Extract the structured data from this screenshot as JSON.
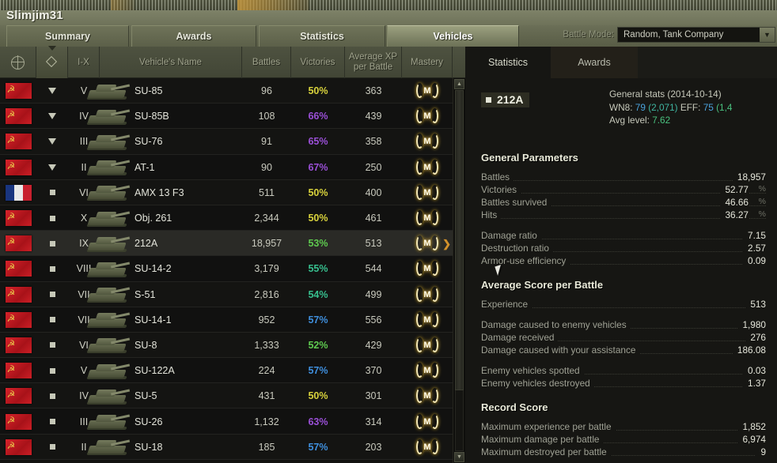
{
  "account": {
    "nickname": "Slimjim31"
  },
  "main_tabs": [
    {
      "label": "Summary",
      "active": false
    },
    {
      "label": "Awards",
      "active": false
    },
    {
      "label": "Statistics",
      "active": false
    },
    {
      "label": "Vehicles",
      "active": true
    }
  ],
  "battle_mode": {
    "label": "Battle Mode:",
    "value": "Random, Tank Company",
    "arrow_icon": "chevron-down-icon"
  },
  "table": {
    "columns": [
      {
        "key": "nation",
        "label": "",
        "icon": "globe-icon"
      },
      {
        "key": "class",
        "label": "",
        "icon": "vehicle-class-icon",
        "sorted": true
      },
      {
        "key": "tier",
        "label": "I-X"
      },
      {
        "key": "name",
        "label": "Vehicle's Name"
      },
      {
        "key": "battles",
        "label": "Battles"
      },
      {
        "key": "victories",
        "label": "Victories"
      },
      {
        "key": "avg_xp",
        "label": "Average XP\nper Battle",
        "line1": "Average XP",
        "line2": "per Battle"
      },
      {
        "key": "mastery",
        "label": "Mastery"
      }
    ],
    "rows": [
      {
        "nation": "ussr",
        "class": "td",
        "tier": "V",
        "name": "SU-85",
        "battles": "96",
        "victories": "50%",
        "pct_color": "#d8d23c",
        "avg_xp": "363",
        "mastery": "M",
        "selected": false
      },
      {
        "nation": "ussr",
        "class": "td",
        "tier": "IV",
        "name": "SU-85B",
        "battles": "108",
        "victories": "66%",
        "pct_color": "#9a4fd6",
        "avg_xp": "439",
        "mastery": "M",
        "selected": false
      },
      {
        "nation": "ussr",
        "class": "td",
        "tier": "III",
        "name": "SU-76",
        "battles": "91",
        "victories": "65%",
        "pct_color": "#9a4fd6",
        "avg_xp": "358",
        "mastery": "M",
        "selected": false
      },
      {
        "nation": "ussr",
        "class": "td",
        "tier": "II",
        "name": "AT-1",
        "battles": "90",
        "victories": "67%",
        "pct_color": "#9a4fd6",
        "avg_xp": "250",
        "mastery": "M",
        "selected": false
      },
      {
        "nation": "france",
        "class": "spg",
        "tier": "VI",
        "name": "AMX 13 F3",
        "battles": "511",
        "victories": "50%",
        "pct_color": "#d8d23c",
        "avg_xp": "400",
        "mastery": "M",
        "selected": false
      },
      {
        "nation": "ussr",
        "class": "spg",
        "tier": "X",
        "name": "Obj. 261",
        "battles": "2,344",
        "victories": "50%",
        "pct_color": "#d8d23c",
        "avg_xp": "461",
        "mastery": "M",
        "selected": false
      },
      {
        "nation": "ussr",
        "class": "spg",
        "tier": "IX",
        "name": "212A",
        "battles": "18,957",
        "victories": "53%",
        "pct_color": "#5ec94f",
        "avg_xp": "513",
        "mastery": "M",
        "selected": true
      },
      {
        "nation": "ussr",
        "class": "spg",
        "tier": "VIII",
        "name": "SU-14-2",
        "battles": "3,179",
        "victories": "55%",
        "pct_color": "#37bf8e",
        "avg_xp": "544",
        "mastery": "M",
        "selected": false
      },
      {
        "nation": "ussr",
        "class": "spg",
        "tier": "VII",
        "name": "S-51",
        "battles": "2,816",
        "victories": "54%",
        "pct_color": "#37bf8e",
        "avg_xp": "499",
        "mastery": "M",
        "selected": false
      },
      {
        "nation": "ussr",
        "class": "spg",
        "tier": "VII",
        "name": "SU-14-1",
        "battles": "952",
        "victories": "57%",
        "pct_color": "#3f8fdd",
        "avg_xp": "556",
        "mastery": "M",
        "selected": false
      },
      {
        "nation": "ussr",
        "class": "spg",
        "tier": "VI",
        "name": "SU-8",
        "battles": "1,333",
        "victories": "52%",
        "pct_color": "#5ec94f",
        "avg_xp": "429",
        "mastery": "M",
        "selected": false
      },
      {
        "nation": "ussr",
        "class": "spg",
        "tier": "V",
        "name": "SU-122A",
        "battles": "224",
        "victories": "57%",
        "pct_color": "#3f8fdd",
        "avg_xp": "370",
        "mastery": "M",
        "selected": false
      },
      {
        "nation": "ussr",
        "class": "spg",
        "tier": "IV",
        "name": "SU-5",
        "battles": "431",
        "victories": "50%",
        "pct_color": "#d8d23c",
        "avg_xp": "301",
        "mastery": "M",
        "selected": false
      },
      {
        "nation": "ussr",
        "class": "spg",
        "tier": "III",
        "name": "SU-26",
        "battles": "1,132",
        "victories": "63%",
        "pct_color": "#9a4fd6",
        "avg_xp": "314",
        "mastery": "M",
        "selected": false
      },
      {
        "nation": "ussr",
        "class": "spg",
        "tier": "II",
        "name": "SU-18",
        "battles": "185",
        "victories": "57%",
        "pct_color": "#3f8fdd",
        "avg_xp": "203",
        "mastery": "M",
        "selected": false
      }
    ]
  },
  "panel": {
    "tabs": [
      {
        "label": "Statistics",
        "active": true
      },
      {
        "label": "Awards",
        "active": false
      }
    ],
    "vehicle": {
      "name": "212A",
      "marker_icon": "square-marker-icon"
    },
    "general_stats": {
      "line1": "General stats (2014-10-14)",
      "wn8_label": "WN8:",
      "wn8_rating": "79",
      "wn8_value": "(2,071)",
      "eff_label": "EFF:",
      "eff_rating": "75",
      "eff_value": "(1,4",
      "avg_level_label": "Avg level:",
      "avg_level_value": "7.62"
    },
    "sections": [
      {
        "title": "General Parameters",
        "rows": [
          {
            "label": "Battles",
            "value": "18,957",
            "unit": ""
          },
          {
            "label": "Victories",
            "value": "52.77",
            "unit": "%"
          },
          {
            "label": "Battles survived",
            "value": "46.66",
            "unit": "%"
          },
          {
            "label": "Hits",
            "value": "36.27",
            "unit": "%"
          }
        ],
        "rows2": [
          {
            "label": "Damage ratio",
            "value": "7.15",
            "unit": ""
          },
          {
            "label": "Destruction ratio",
            "value": "2.57",
            "unit": ""
          },
          {
            "label": "Armor-use efficiency",
            "value": "0.09",
            "unit": ""
          }
        ]
      },
      {
        "title": "Average Score per Battle",
        "rows": [
          {
            "label": "Experience",
            "value": "513",
            "unit": ""
          }
        ],
        "rows2": [
          {
            "label": "Damage caused to enemy vehicles",
            "value": "1,980",
            "unit": ""
          },
          {
            "label": "Damage received",
            "value": "276",
            "unit": ""
          },
          {
            "label": "Damage caused with your assistance",
            "value": "186.08",
            "unit": ""
          }
        ],
        "rows3": [
          {
            "label": "Enemy vehicles spotted",
            "value": "0.03",
            "unit": ""
          },
          {
            "label": "Enemy vehicles destroyed",
            "value": "1.37",
            "unit": ""
          }
        ]
      },
      {
        "title": "Record Score",
        "rows": [
          {
            "label": "Maximum experience per battle",
            "value": "1,852",
            "unit": ""
          },
          {
            "label": "Maximum damage per battle",
            "value": "6,974",
            "unit": ""
          },
          {
            "label": "Maximum destroyed per battle",
            "value": "9",
            "unit": ""
          }
        ]
      }
    ]
  }
}
